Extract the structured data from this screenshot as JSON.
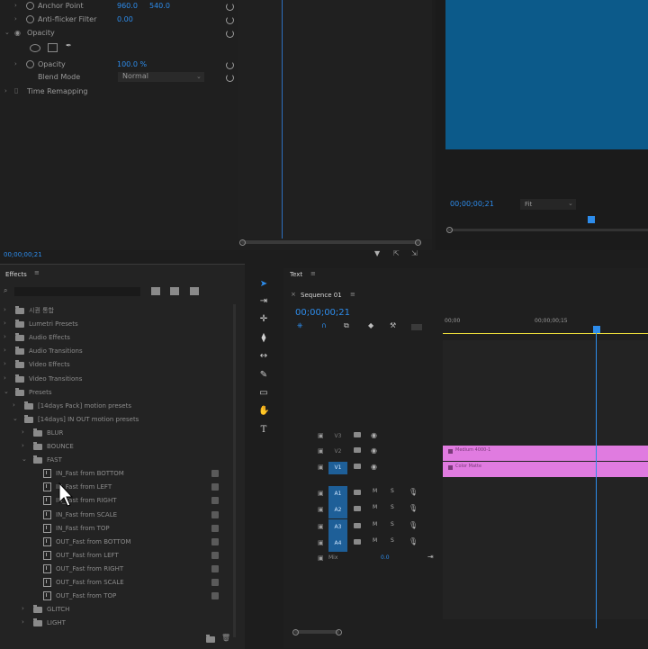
{
  "effect_controls": {
    "rows": [
      {
        "label": "Anchor Point",
        "value1": "960.0",
        "value2": "540.0"
      },
      {
        "label": "Anti-flicker Filter",
        "value1": "0.00"
      },
      {
        "label": "Opacity"
      },
      {
        "label": "Opacity",
        "value1": "100.0 %"
      },
      {
        "label": "Blend Mode",
        "value1": "Normal"
      },
      {
        "label": "Time Remapping"
      }
    ],
    "timecode": "00;00;00;21"
  },
  "program_monitor": {
    "timecode": "00;00;00;21",
    "fit": "Fit",
    "preview_color": "#0c5a8a"
  },
  "effects_panel": {
    "title": "Effects",
    "items": [
      {
        "label": "시퀀 통합",
        "type": "folder",
        "depth": 0,
        "expanded": false
      },
      {
        "label": "Lumetri Presets",
        "type": "folder",
        "depth": 0,
        "expanded": false
      },
      {
        "label": "Audio Effects",
        "type": "folder",
        "depth": 0,
        "expanded": false
      },
      {
        "label": "Audio Transitions",
        "type": "folder",
        "depth": 0,
        "expanded": false
      },
      {
        "label": "Video Effects",
        "type": "folder",
        "depth": 0,
        "expanded": false
      },
      {
        "label": "Video Transitions",
        "type": "folder",
        "depth": 0,
        "expanded": false
      },
      {
        "label": "Presets",
        "type": "folder",
        "depth": 0,
        "expanded": true
      },
      {
        "label": "[14days Pack] motion presets",
        "type": "folder",
        "depth": 1,
        "expanded": false
      },
      {
        "label": "[14days] IN OUT motion presets",
        "type": "folder",
        "depth": 1,
        "expanded": true
      },
      {
        "label": "BLUR",
        "type": "folder",
        "depth": 2,
        "expanded": false
      },
      {
        "label": "BOUNCE",
        "type": "folder",
        "depth": 2,
        "expanded": false
      },
      {
        "label": "FAST",
        "type": "folder",
        "depth": 2,
        "expanded": true
      },
      {
        "label": "IN_Fast from BOTTOM",
        "type": "preset",
        "depth": 3
      },
      {
        "label": "IN_Fast from LEFT",
        "type": "preset",
        "depth": 3
      },
      {
        "label": "IN_Fast from RIGHT",
        "type": "preset",
        "depth": 3
      },
      {
        "label": "IN_Fast from SCALE",
        "type": "preset",
        "depth": 3
      },
      {
        "label": "IN_Fast from TOP",
        "type": "preset",
        "depth": 3
      },
      {
        "label": "OUT_Fast from BOTTOM",
        "type": "preset",
        "depth": 3
      },
      {
        "label": "OUT_Fast from LEFT",
        "type": "preset",
        "depth": 3
      },
      {
        "label": "OUT_Fast from RIGHT",
        "type": "preset",
        "depth": 3
      },
      {
        "label": "OUT_Fast from SCALE",
        "type": "preset",
        "depth": 3
      },
      {
        "label": "OUT_Fast from TOP",
        "type": "preset",
        "depth": 3
      },
      {
        "label": "GLITCH",
        "type": "folder",
        "depth": 2,
        "expanded": false
      },
      {
        "label": "LIGHT",
        "type": "folder",
        "depth": 2,
        "expanded": false
      }
    ]
  },
  "timeline": {
    "panel_title": "Text",
    "sequence_tab": "Sequence 01",
    "timecode": "00;00;00;21",
    "ruler": [
      "00;00",
      "00;00;00;15"
    ],
    "video_tracks": [
      {
        "name": "V3"
      },
      {
        "name": "V2"
      },
      {
        "name": "V1"
      }
    ],
    "audio_tracks": [
      {
        "name": "A1"
      },
      {
        "name": "A2"
      },
      {
        "name": "A3"
      },
      {
        "name": "A4"
      }
    ],
    "mix_label": "Mix",
    "mix_value": "0.0",
    "clips": [
      {
        "name": "Medium 4000-1",
        "color": "#e07be0"
      },
      {
        "name": "Color Matte",
        "color": "#e07be0"
      }
    ]
  }
}
